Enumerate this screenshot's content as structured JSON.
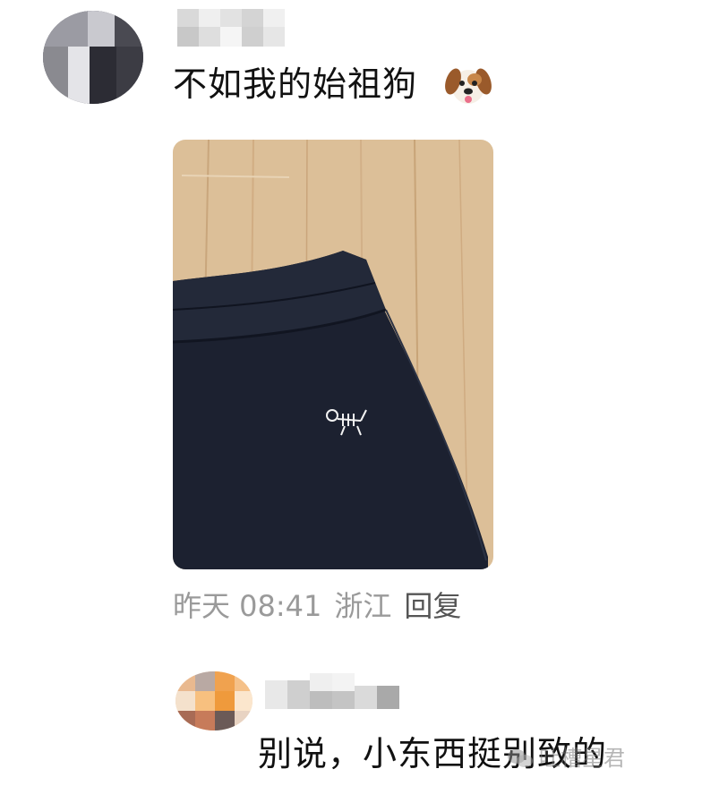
{
  "comments": [
    {
      "text": "不如我的始祖狗",
      "emoji": "dog-face",
      "meta": {
        "time": "昨天 08:41",
        "location": "浙江",
        "reply_label": "回复"
      }
    },
    {
      "text": "别说，小东西挺别致的"
    }
  ],
  "watermark": {
    "text": "吐槽星君",
    "icon": "wechat-icon"
  },
  "colors": {
    "wood": "#ddc09a",
    "pants": "#1c2130",
    "meta_gray": "#9a9a9a"
  }
}
